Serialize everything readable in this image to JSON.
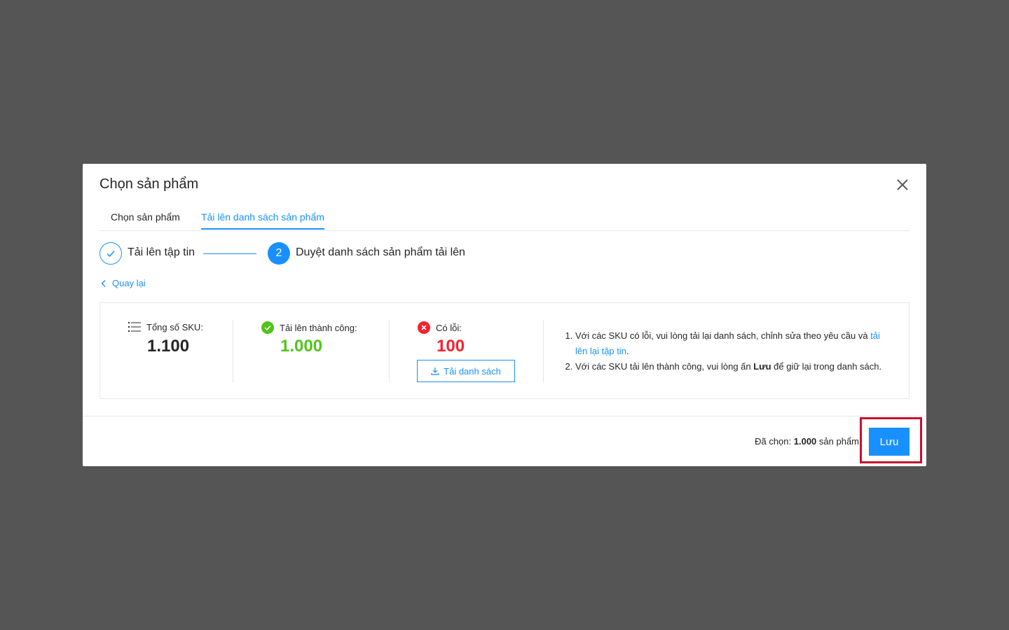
{
  "modal": {
    "title": "Chọn sản phẩm"
  },
  "tabs": [
    {
      "label": "Chọn sản phẩm"
    },
    {
      "label": "Tải lên danh sách sản phẩm"
    }
  ],
  "steps": [
    {
      "label": "Tải lên tập tin"
    },
    {
      "number": "2",
      "label": "Duyệt danh sách sản phẩm tải lên"
    }
  ],
  "back_label": "Quay lại",
  "stats": {
    "total": {
      "label": "Tổng số SKU:",
      "value": "1.100"
    },
    "success": {
      "label": "Tải lên thành công:",
      "value": "1.000",
      "color": "#52c41a"
    },
    "error": {
      "label": "Có lỗi:",
      "value": "100",
      "color": "#f5222d"
    },
    "download_label": "Tải danh sách"
  },
  "notes": {
    "note1_text": "Với các SKU có lỗi,  vui lòng tải lại danh sách, chỉnh sửa theo yêu cầu và ",
    "note1_link": "tải lên lại tập tin",
    "note1_end": ".",
    "note2_pre": "Với các SKU tải lên thành công, vui lòng ấn ",
    "note2_bold": "Lưu",
    "note2_post": " để giữ lại trong danh sách."
  },
  "footer": {
    "selected_pre": "Đã chọn: ",
    "selected_count": "1.000",
    "selected_post": " sản phẩm",
    "save_label": "Lưu"
  },
  "colors": {
    "primary": "#1890ff",
    "highlight": "#c8102e"
  }
}
